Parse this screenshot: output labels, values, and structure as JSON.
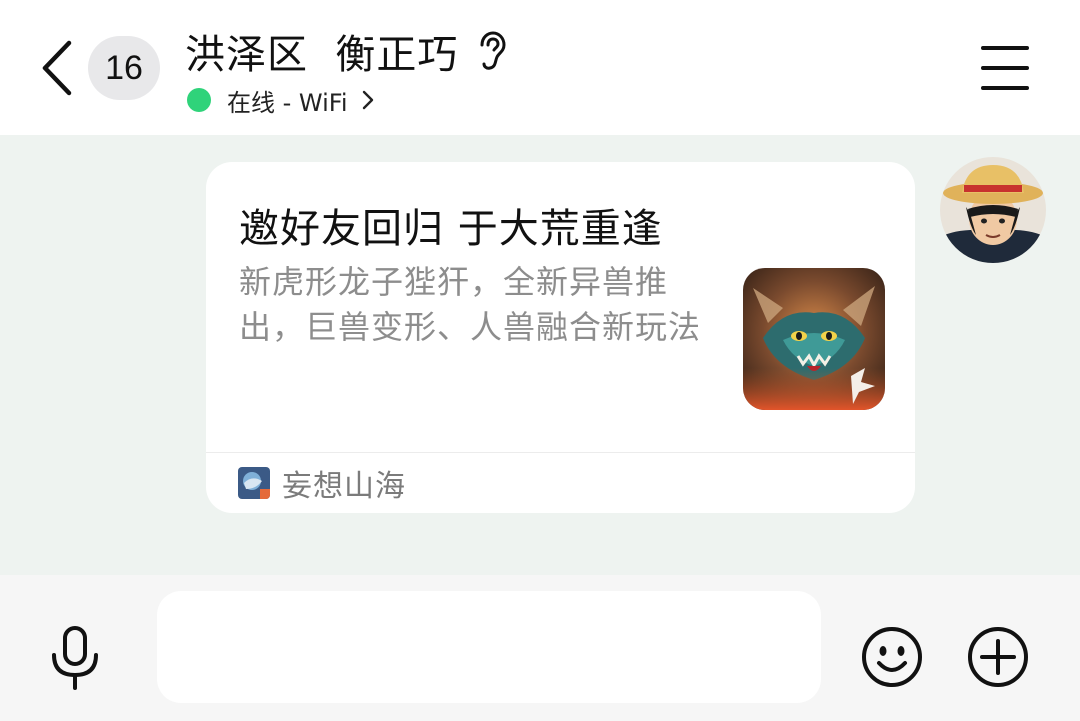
{
  "header": {
    "back_icon": "chevron-left-icon",
    "unread_count": "16",
    "title": "洪泽区  衡正巧",
    "ear_icon": "ear-icon",
    "status_text": "在线 - WiFi",
    "status_color": "#2fd37a",
    "menu_icon": "hamburger-menu-icon"
  },
  "chat": {
    "background": "#eef3f0",
    "message": {
      "title": "邀好友回归 于大荒重逢",
      "description": "新虎形龙子狴犴，全新异兽推出，巨兽变形、人兽融合新玩法",
      "thumbnail": "game-dragon-thumbnail",
      "source_label": "妄想山海",
      "source_icon": "game-app-icon"
    },
    "avatar": "user-avatar"
  },
  "input_bar": {
    "voice_icon": "microphone-icon",
    "input_value": "",
    "emoji_icon": "smiley-icon",
    "more_icon": "plus-circle-icon"
  }
}
